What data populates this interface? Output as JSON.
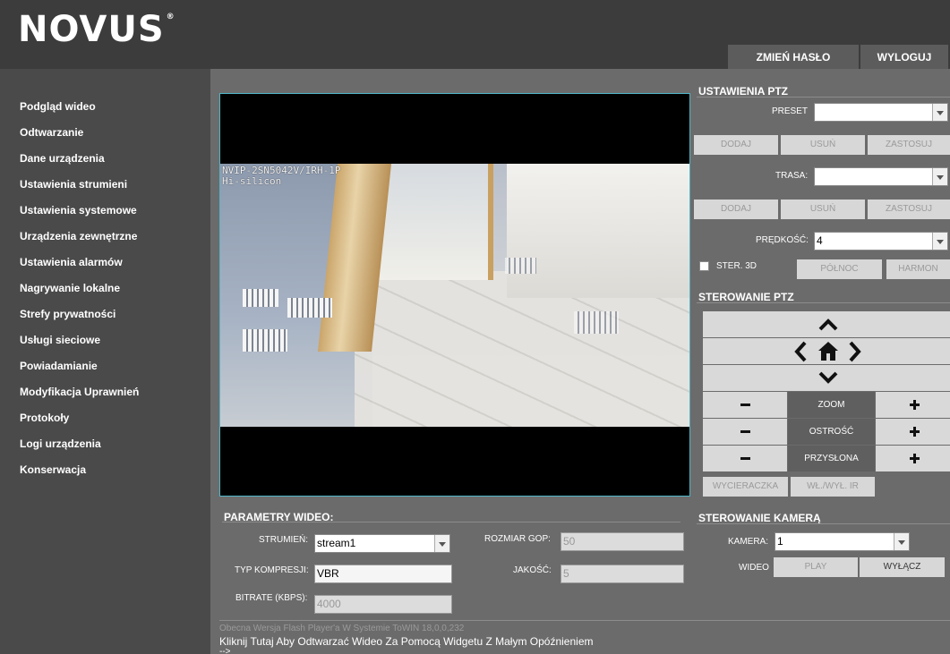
{
  "header": {
    "logo": "NOVUS",
    "logo_mark": "®",
    "change_password": "ZMIEŃ HASŁO",
    "logout": "WYLOGUJ"
  },
  "sidebar": {
    "items": [
      {
        "label": "Podgląd wideo"
      },
      {
        "label": "Odtwarzanie"
      },
      {
        "label": "Dane urządzenia"
      },
      {
        "label": "Ustawienia strumieni"
      },
      {
        "label": "Ustawienia systemowe"
      },
      {
        "label": "Urządzenia zewnętrzne"
      },
      {
        "label": "Ustawienia alarmów"
      },
      {
        "label": "Nagrywanie lokalne"
      },
      {
        "label": "Strefy prywatności"
      },
      {
        "label": "Usługi sieciowe"
      },
      {
        "label": "Powiadamianie"
      },
      {
        "label": "Modyfikacja Uprawnień"
      },
      {
        "label": "Protokoły"
      },
      {
        "label": "Logi urządzenia"
      },
      {
        "label": "Konserwacja"
      }
    ]
  },
  "video": {
    "overlay_line1": "NVIP-2SN5042V/IRH-1P",
    "overlay_line2": "Hi-silicon"
  },
  "video_params": {
    "title": "PARAMETRY WIDEO:",
    "stream_label": "STRUMIEŃ:",
    "stream_value": "stream1",
    "compression_label": "TYP KOMPRESJI:",
    "compression_value": "VBR",
    "bitrate_label": "BITRATE (KBPS):",
    "bitrate_value": "4000",
    "gop_label": "ROZMIAR GOP:",
    "gop_value": "50",
    "quality_label": "JAKOŚĆ:",
    "quality_value": "5"
  },
  "ptz_settings": {
    "title": "USTAWIENIA PTZ",
    "preset_label": "PRESET",
    "preset_value": "",
    "add": "DODAJ",
    "remove": "USUŃ",
    "apply": "ZASTOSUJ",
    "route_label": "TRASA:",
    "route_value": "",
    "speed_label": "PRĘDKOŚĆ:",
    "speed_value": "4",
    "ster3d_label": "STER. 3D",
    "north": "PÓŁNOC",
    "harmony": "HARMON"
  },
  "ptz_control": {
    "title": "STEROWANIE PTZ",
    "zoom": "ZOOM",
    "focus": "OSTROŚĆ",
    "iris": "PRZYSŁONA",
    "wiper": "WYCIERACZKA",
    "ir": "WŁ./WYŁ. IR",
    "minus": "−",
    "plus": "+"
  },
  "camera_control": {
    "title": "STEROWANIE KAMERĄ",
    "camera_label": "KAMERA:",
    "camera_value": "1",
    "video_label": "WIDEO",
    "play": "PLAY",
    "off": "WYŁĄCZ"
  },
  "footer": {
    "version": "Obecna Wersja Flash Player'a W Systemie ToWIN 18,0,0,232",
    "link": "Kliknij Tutaj Aby Odtwarzać Wideo Za Pomocą Widgetu Z Małym Opóźnieniem",
    "tail": "-->"
  },
  "colors": {
    "header_bg": "#3c3c3c",
    "sidebar_bg": "#4a4a4a",
    "content_bg": "#6b6b6b",
    "video_border": "#4fb6c9"
  }
}
